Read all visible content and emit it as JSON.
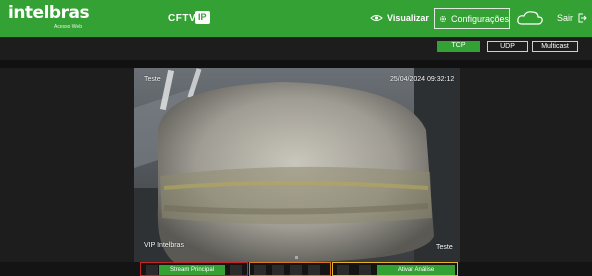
{
  "header": {
    "brand": "intelbras",
    "brand_sub": "Acesso Web",
    "product": "CFTV",
    "product_badge": "IP",
    "nav": {
      "view": "Visualizar",
      "config": "Configurações",
      "cloud_badge": "Intelbras Cloud",
      "exit": "Sair"
    }
  },
  "protocols": {
    "tcp": "TCP",
    "udp": "UDP",
    "multicast": "Multicast",
    "selected": "TCP"
  },
  "video": {
    "overlay_top_left": "Teste",
    "overlay_timestamp": "25/04/2024 09:32:12",
    "overlay_bottom_left": "VIP Intelbras",
    "overlay_bottom_right": "Teste"
  },
  "toolbar": {
    "stream_label": "Stream Principal",
    "analysis_label": "Ativar Análise"
  },
  "colors": {
    "brand_green": "#33a133",
    "red_group": "#c22525",
    "orange_group": "#d9791a",
    "yellow_group": "#e3b325"
  }
}
